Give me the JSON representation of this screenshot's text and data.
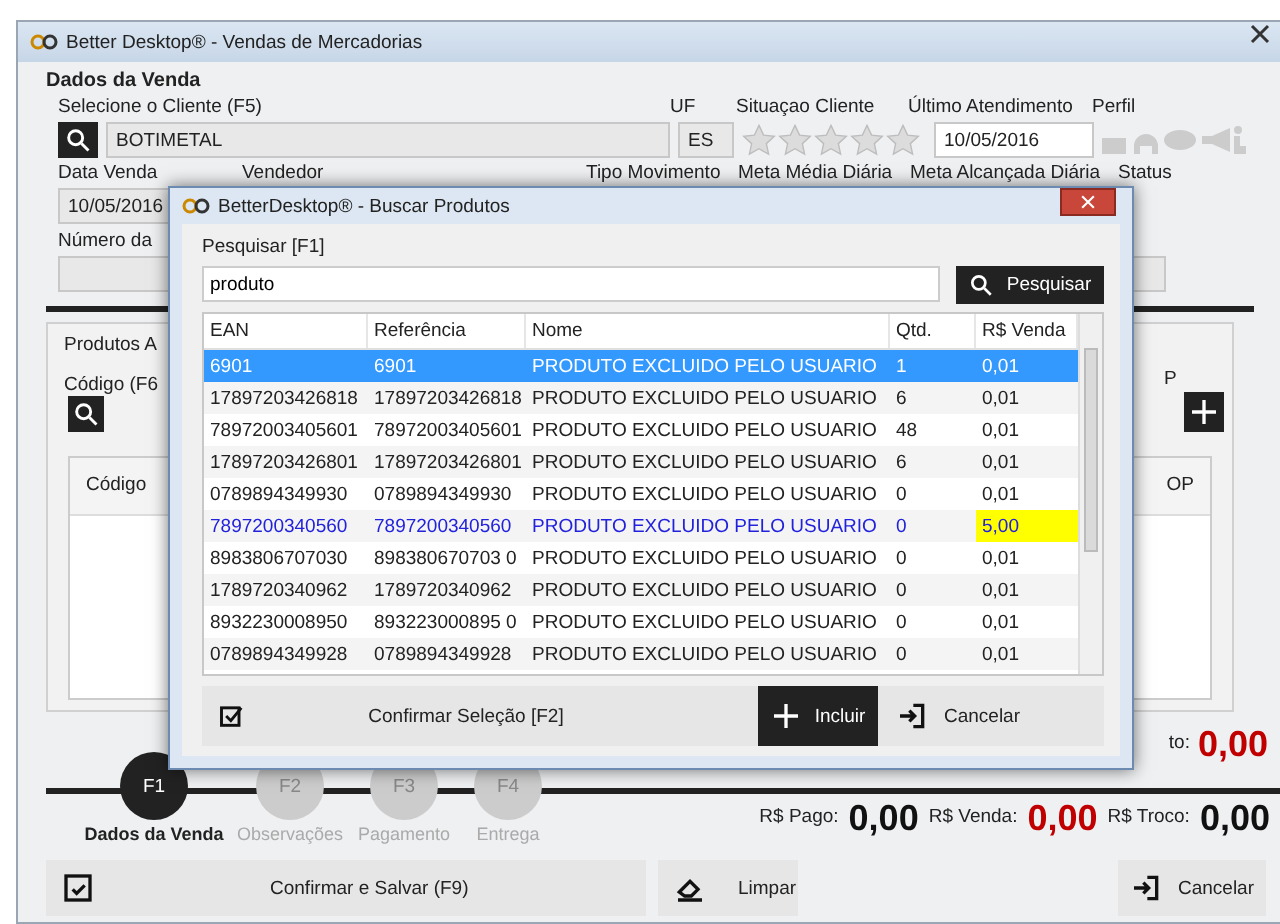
{
  "window": {
    "title": "Better Desktop® - Vendas de Mercadorias"
  },
  "sale": {
    "heading": "Dados da Venda",
    "client_label": "Selecione o Cliente (F5)",
    "client": "BOTIMETAL",
    "uf_label": "UF",
    "uf": "ES",
    "situation_label": "Situaçao Cliente",
    "stars": 0,
    "last_label": "Último Atendimento",
    "last_date": "10/05/2016",
    "profile_label": "Perfil",
    "date_label": "Data Venda",
    "seller_label": "Vendedor",
    "movement_label": "Tipo Movimento",
    "goal_label": "Meta Média Diária",
    "reached_label": "Meta Alcançada Diária",
    "status_label": "Status",
    "date": "10/05/2016",
    "number_label": "Número da"
  },
  "products": {
    "tab": "Produtos A",
    "code_label": "Código (F6",
    "right_label": "P",
    "columns": [
      "Código",
      "OP"
    ]
  },
  "total": {
    "label": "to:",
    "value": "0,00"
  },
  "steps": [
    {
      "key": "F1",
      "label": "Dados da Venda",
      "selected": true
    },
    {
      "key": "F2",
      "label": "Observações",
      "selected": false
    },
    {
      "key": "F3",
      "label": "Pagamento",
      "selected": false
    },
    {
      "key": "F4",
      "label": "Entrega",
      "selected": false
    }
  ],
  "amounts": [
    {
      "label": "R$ Pago:",
      "value": "0,00",
      "alert": false
    },
    {
      "label": "R$ Venda:",
      "value": "0,00",
      "alert": true
    },
    {
      "label": "R$ Troco:",
      "value": "0,00",
      "alert": false
    }
  ],
  "actions": {
    "confirm": "Confirmar e Salvar (F9)",
    "clear": "Limpar",
    "cancel": "Cancelar"
  },
  "dialog": {
    "title": "BetterDesktop® - Buscar Produtos",
    "search_label": "Pesquisar [F1]",
    "search_value": "produto",
    "search_button": "Pesquisar",
    "columns": [
      "EAN",
      "Referência",
      "Nome",
      "Qtd.",
      "R$ Venda"
    ],
    "rows": [
      {
        "cells": [
          "6901",
          "6901",
          "PRODUTO EXCLUIDO PELO USUARIO",
          "1",
          "0,01"
        ],
        "selected": true,
        "flagged": false
      },
      {
        "cells": [
          "17897203426818",
          "17897203426818",
          "PRODUTO EXCLUIDO PELO USUARIO",
          "6",
          "0,01"
        ],
        "selected": false,
        "flagged": false
      },
      {
        "cells": [
          "78972003405601",
          "78972003405601",
          "PRODUTO EXCLUIDO PELO USUARIO",
          "48",
          "0,01"
        ],
        "selected": false,
        "flagged": false
      },
      {
        "cells": [
          "17897203426801",
          "17897203426801",
          "PRODUTO EXCLUIDO PELO USUARIO",
          "6",
          "0,01"
        ],
        "selected": false,
        "flagged": false
      },
      {
        "cells": [
          "0789894349930",
          "0789894349930",
          "PRODUTO EXCLUIDO PELO USUARIO",
          "0",
          "0,01"
        ],
        "selected": false,
        "flagged": false
      },
      {
        "cells": [
          "7897200340560",
          "7897200340560",
          "PRODUTO EXCLUIDO PELO USUARIO",
          "0",
          "5,00"
        ],
        "selected": false,
        "flagged": true
      },
      {
        "cells": [
          "8983806707030",
          "898380670703 0",
          "PRODUTO EXCLUIDO PELO USUARIO",
          "0",
          "0,01"
        ],
        "selected": false,
        "flagged": false
      },
      {
        "cells": [
          "1789720340962",
          "1789720340962",
          "PRODUTO EXCLUIDO PELO USUARIO",
          "0",
          "0,01"
        ],
        "selected": false,
        "flagged": false
      },
      {
        "cells": [
          "8932230008950",
          "893223000895 0",
          "PRODUTO EXCLUIDO PELO USUARIO",
          "0",
          "0,01"
        ],
        "selected": false,
        "flagged": false
      },
      {
        "cells": [
          "0789894349928",
          "0789894349928",
          "PRODUTO EXCLUIDO PELO USUARIO",
          "0",
          "0,01"
        ],
        "selected": false,
        "flagged": false
      }
    ],
    "confirm": "Confirmar Seleção [F2]",
    "include": "Incluir",
    "cancel": "Cancelar"
  }
}
